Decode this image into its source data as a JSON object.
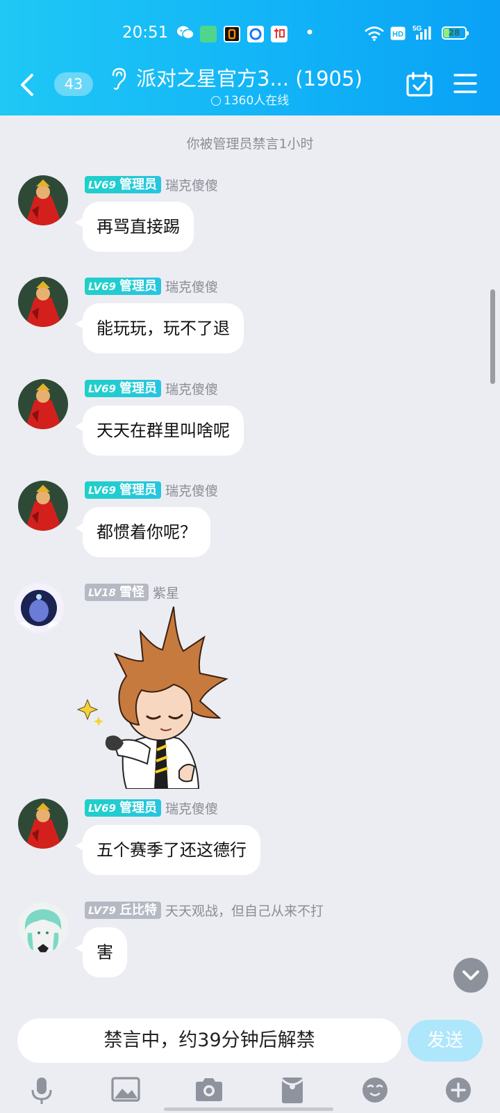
{
  "status_bar": {
    "time": "20:51",
    "network": "5G",
    "hd": "HD",
    "battery_level": 28,
    "app_icons": [
      "wechat-icon",
      "app-green-icon",
      "app-orange-icon",
      "app-blue-icon",
      "app-zhi-icon"
    ]
  },
  "header": {
    "unread_count": "43",
    "title": "派对之星官方3... (1905)",
    "online": "1360人在线"
  },
  "system_notice": "你被管理员禁言1小时",
  "messages": [
    {
      "level": "LV69",
      "title": "管理员",
      "nick": "瑞克傻傻",
      "text": "再骂直接踢"
    },
    {
      "level": "LV69",
      "title": "管理员",
      "nick": "瑞克傻傻",
      "text": "能玩玩，玩不了退"
    },
    {
      "level": "LV69",
      "title": "管理员",
      "nick": "瑞克傻傻",
      "text": "天天在群里叫啥呢"
    },
    {
      "level": "LV69",
      "title": "管理员",
      "nick": "瑞克傻傻",
      "text": "都惯着你呢？"
    },
    {
      "level": "LV18",
      "title": "雪怪",
      "nick": "紫星",
      "text": ""
    },
    {
      "level": "LV69",
      "title": "管理员",
      "nick": "瑞克傻傻",
      "text": "五个赛季了还这德行"
    },
    {
      "level": "LV79",
      "title": "丘比特",
      "nick": "天天观战，但自己从来不打",
      "text": "害"
    }
  ],
  "input": {
    "muted_text": "禁言中，约39分钟后解禁",
    "send_label": "发送"
  },
  "toolbar": [
    "microphone-icon",
    "image-icon",
    "camera-icon",
    "red-packet-icon",
    "emoji-icon",
    "plus-icon"
  ],
  "colors": {
    "header_start": "#1fc8f5",
    "header_end": "#0aa1f6",
    "admin_badge": "#1fd0c8",
    "member_badge": "#b5b9c4",
    "send_disabled": "#aee6fb"
  }
}
